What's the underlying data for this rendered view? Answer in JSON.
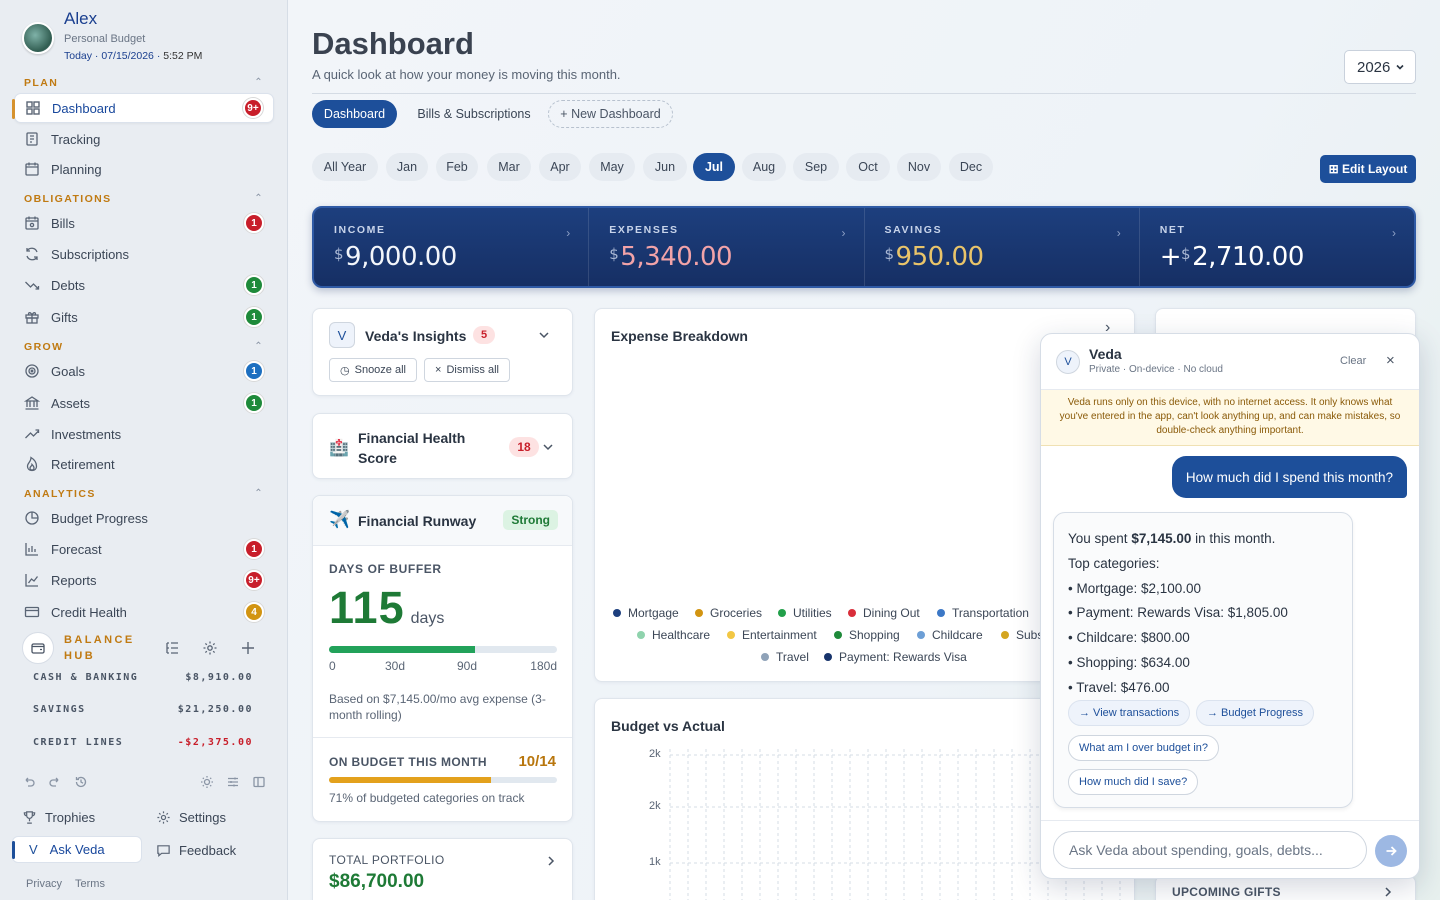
{
  "profile": {
    "name": "Alex",
    "subtitle": "Personal Budget",
    "today_label": "Today · 07/15/2026",
    "time": "5:52 PM"
  },
  "sidebar": {
    "sections": {
      "plan": "PLAN",
      "obligations": "OBLIGATIONS",
      "grow": "GROW",
      "analytics": "ANALYTICS"
    },
    "items": [
      {
        "label": "Dashboard",
        "badge": "9+",
        "icon": "grid-icon"
      },
      {
        "label": "Tracking",
        "badge": "",
        "icon": "receipt-icon"
      },
      {
        "label": "Planning",
        "badge": "",
        "icon": "calendar-icon"
      },
      {
        "label": "Bills",
        "badge": "1",
        "icon": "calendar-bill-icon"
      },
      {
        "label": "Subscriptions",
        "badge": "",
        "icon": "refresh-icon"
      },
      {
        "label": "Debts",
        "badge": "1",
        "icon": "trend-down-icon"
      },
      {
        "label": "Gifts",
        "badge": "1",
        "icon": "gift-icon"
      },
      {
        "label": "Goals",
        "badge": "1",
        "icon": "target-icon"
      },
      {
        "label": "Assets",
        "badge": "1",
        "icon": "bank-icon"
      },
      {
        "label": "Investments",
        "badge": "",
        "icon": "trend-up-icon"
      },
      {
        "label": "Retirement",
        "badge": "",
        "icon": "flame-icon"
      },
      {
        "label": "Budget Progress",
        "badge": "",
        "icon": "pie-icon"
      },
      {
        "label": "Forecast",
        "badge": "1",
        "icon": "bar-chart-icon"
      },
      {
        "label": "Reports",
        "badge": "9+",
        "icon": "line-chart-icon"
      },
      {
        "label": "Credit Health",
        "badge": "4",
        "icon": "credit-card-icon"
      }
    ],
    "balance_hub": {
      "title": "BALANCE HUB",
      "rows": [
        {
          "label": "CASH & BANKING",
          "value": "$8,910.00"
        },
        {
          "label": "SAVINGS",
          "value": "$21,250.00"
        },
        {
          "label": "CREDIT LINES",
          "value": "-$2,375.00"
        }
      ]
    },
    "footer": {
      "trophies": "Trophies",
      "settings": "Settings",
      "ask_veda": "Ask Veda",
      "feedback": "Feedback",
      "privacy": "Privacy",
      "terms": "Terms"
    }
  },
  "header": {
    "title": "Dashboard",
    "subtitle": "A quick look at how your money is moving this month.",
    "year": "2026"
  },
  "tabs": [
    "Dashboard",
    "Bills & Subscriptions",
    "+ New Dashboard"
  ],
  "months": [
    "All Year",
    "Jan",
    "Feb",
    "Mar",
    "Apr",
    "May",
    "Jun",
    "Jul",
    "Aug",
    "Sep",
    "Oct",
    "Nov",
    "Dec"
  ],
  "selected_month": "Jul",
  "edit_layout": "⊞ Edit Layout",
  "summary": [
    {
      "label": "INCOME",
      "currency": "$",
      "amount": "9,000.00",
      "prefix": "",
      "color": "#f3f6fb"
    },
    {
      "label": "EXPENSES",
      "currency": "$",
      "amount": "5,340.00",
      "prefix": "",
      "color": "#f2a3a8"
    },
    {
      "label": "SAVINGS",
      "currency": "$",
      "amount": "950.00",
      "prefix": "",
      "color": "#e9c46a"
    },
    {
      "label": "NET",
      "currency": "$",
      "amount": "2,710.00",
      "prefix": "+",
      "color": "#ffffff"
    }
  ],
  "insights": {
    "title": "Veda's Insights",
    "count": "5",
    "snooze": "Snooze all",
    "dismiss": "Dismiss all"
  },
  "health": {
    "title": "Financial Health Score",
    "score": "18"
  },
  "runway": {
    "title": "Financial Runway",
    "status": "Strong",
    "buffer_label": "DAYS OF BUFFER",
    "days": "115",
    "days_unit": "days",
    "progress": 0.64,
    "scale": [
      "0",
      "30d",
      "90d",
      "180d"
    ],
    "note": "Based on $7,145.00/mo avg expense (3-month rolling)",
    "budget_label": "ON BUDGET THIS MONTH",
    "budget_value": "10/14",
    "budget_progress": 0.71,
    "budget_note": "71% of budgeted categories on track"
  },
  "portfolio": {
    "label": "TOTAL PORTFOLIO",
    "value": "$86,700.00"
  },
  "expense_breakdown": {
    "title": "Expense Breakdown",
    "legend": [
      {
        "name": "Mortgage",
        "color": "#1d3f7e"
      },
      {
        "name": "Groceries",
        "color": "#d29411"
      },
      {
        "name": "Utilities",
        "color": "#22a04a"
      },
      {
        "name": "Dining Out",
        "color": "#d92e3a"
      },
      {
        "name": "Transportation",
        "color": "#3c78c6"
      },
      {
        "name": "Healthcare",
        "color": "#8fd3ad"
      },
      {
        "name": "Entertainment",
        "color": "#f2c744"
      },
      {
        "name": "Shopping",
        "color": "#1f8a3a"
      },
      {
        "name": "Childcare",
        "color": "#6d9fd6"
      },
      {
        "name": "Subs",
        "color": "#d4a520"
      },
      {
        "name": "Travel",
        "color": "#8fa2b8"
      },
      {
        "name": "Payment: Rewards Visa",
        "color": "#17336b"
      }
    ]
  },
  "budget_vs_actual": {
    "title": "Budget vs Actual",
    "ticks": [
      "2k",
      "2k",
      "1k"
    ]
  },
  "upcoming": {
    "label": "UPCOMING GIFTS"
  },
  "veda": {
    "name": "Veda",
    "sub": "Private · On-device · No cloud",
    "clear": "Clear",
    "notice": "Veda runs only on this device, with no internet access. It only knows what you've entered in the app, can't look anything up, and can make mistakes, so double-check anything important.",
    "user_msg": "How much did I spend this month?",
    "reply_pre": "You spent ",
    "reply_amount": "$7,145.00",
    "reply_post": " in this month.",
    "top_label": "Top categories:",
    "top": [
      "• Mortgage: $2,100.00",
      "• Payment: Rewards Visa: $1,805.00",
      "• Childcare: $800.00",
      "• Shopping: $634.00",
      "• Travel: $476.00"
    ],
    "chips": [
      "→ View transactions",
      "→ Budget Progress",
      "What am I over budget in?",
      "How much did I save?"
    ],
    "placeholder": "Ask Veda about spending, goals, debts..."
  }
}
